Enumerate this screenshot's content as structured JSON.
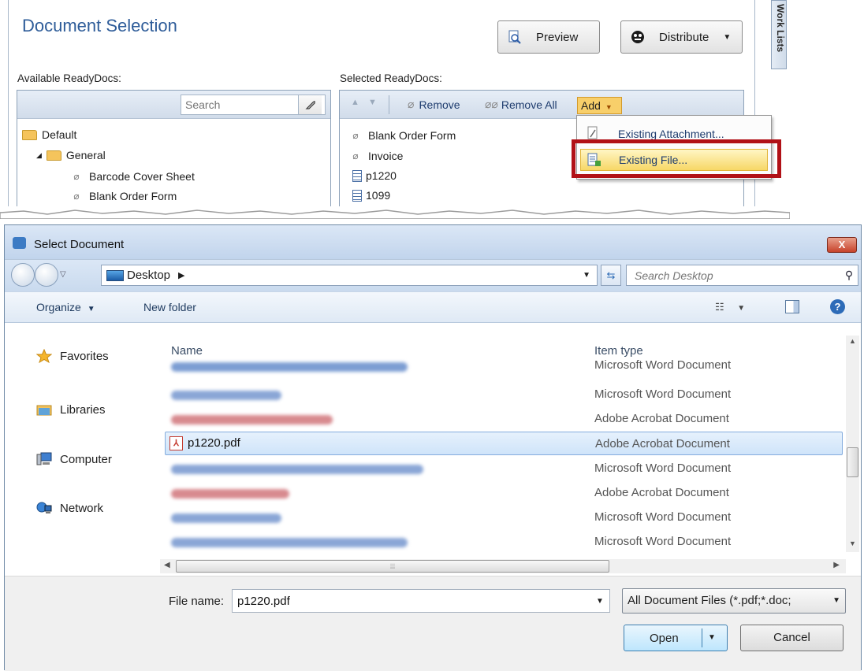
{
  "doc_selection": {
    "title": "Document Selection",
    "preview_label": "Preview",
    "distribute_label": "Distribute",
    "worklists_tab": "Work Lists",
    "available_label": "Available ReadyDocs:",
    "selected_label": "Selected ReadyDocs:",
    "search_placeholder": "Search",
    "available_tree": [
      {
        "label": "Default",
        "icon": "folder-open-icon",
        "level": 0
      },
      {
        "label": "General",
        "icon": "folder-open-icon",
        "level": 1
      },
      {
        "label": "Barcode Cover Sheet",
        "icon": "paperclip-icon",
        "level": 2
      },
      {
        "label": "Blank Order Form",
        "icon": "paperclip-icon",
        "level": 2
      }
    ],
    "selected_toolbar": {
      "remove": "Remove",
      "remove_all": "Remove All",
      "add": "Add"
    },
    "selected_items": [
      {
        "label": "Blank Order Form",
        "icon": "paperclip-icon"
      },
      {
        "label": "Invoice",
        "icon": "paperclip-icon"
      },
      {
        "label": "p1220",
        "icon": "document-icon"
      },
      {
        "label": "1099",
        "icon": "document-icon"
      }
    ],
    "add_menu": {
      "existing_attachment": "Existing Attachment...",
      "existing_file": "Existing File..."
    },
    "highlight_color": "#b11117"
  },
  "dialog": {
    "title": "Select Document",
    "close_glyph": "X",
    "address": "Desktop",
    "search_placeholder": "Search Desktop",
    "organize": "Organize",
    "new_folder": "New folder",
    "nav": {
      "favorites": "Favorites",
      "libraries": "Libraries",
      "computer": "Computer",
      "network": "Network"
    },
    "columns": {
      "name": "Name",
      "type": "Item type"
    },
    "files": [
      {
        "name": "",
        "type": "Microsoft Word Document",
        "blur_color": "#7d9ed3",
        "blur_width": 300
      },
      {
        "name": "",
        "type": "Microsoft Word Document",
        "blur_color": "#8aa6d6",
        "blur_width": 140
      },
      {
        "name": "",
        "type": "Adobe Acrobat Document",
        "blur_color": "#d88a8f",
        "blur_width": 205
      },
      {
        "name": "p1220.pdf",
        "type": "Adobe Acrobat Document",
        "selected": true
      },
      {
        "name": "",
        "type": "Microsoft Word Document",
        "blur_color": "#8aa6d6",
        "blur_width": 320
      },
      {
        "name": "",
        "type": "Adobe Acrobat Document",
        "blur_color": "#d88a8f",
        "blur_width": 150
      },
      {
        "name": "",
        "type": "Microsoft Word Document",
        "blur_color": "#8aa6d6",
        "blur_width": 140
      },
      {
        "name": "",
        "type": "Microsoft Word Document",
        "blur_color": "#8aa6d6",
        "blur_width": 300
      }
    ],
    "file_name_label": "File name:",
    "file_name_value": "p1220.pdf",
    "file_type": "All Document Files (*.pdf;*.doc;",
    "open": "Open",
    "cancel": "Cancel"
  }
}
